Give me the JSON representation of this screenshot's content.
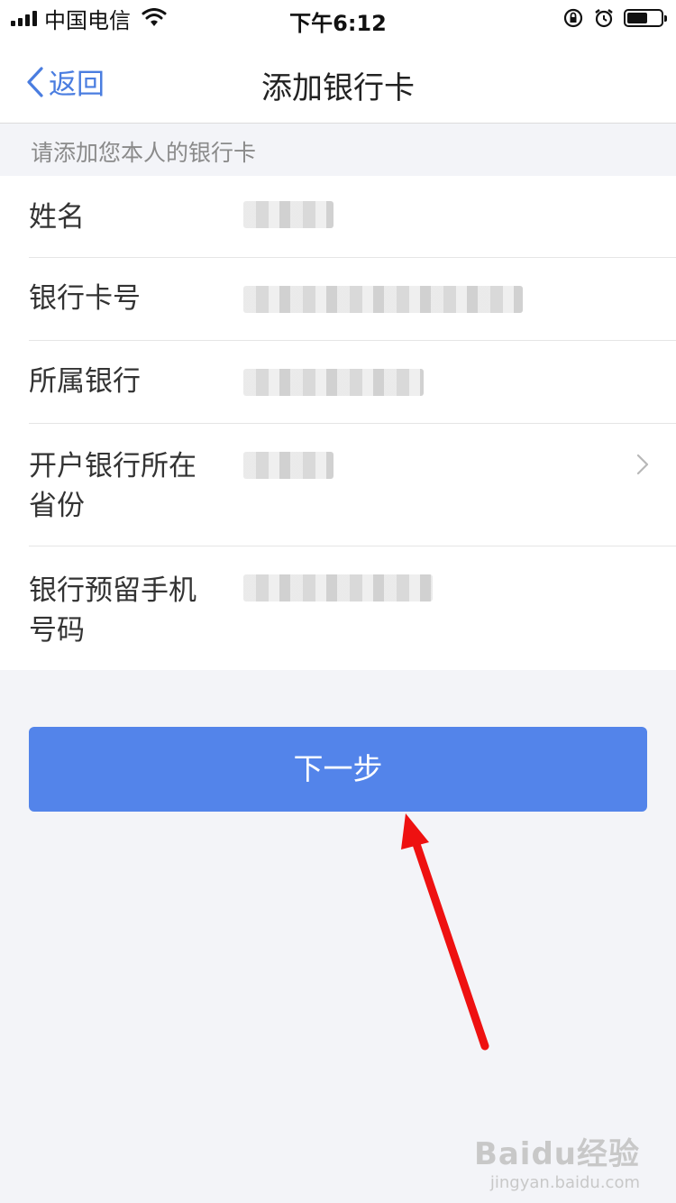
{
  "status_bar": {
    "carrier": "中国电信",
    "time": "下午6:12",
    "battery_level": 0.6
  },
  "nav": {
    "back_label": "返回",
    "title": "添加银行卡"
  },
  "hint": "请添加您本人的银行卡",
  "form": {
    "rows": [
      {
        "label": "姓名"
      },
      {
        "label": "银行卡号"
      },
      {
        "label": "所属银行"
      },
      {
        "label": "开户银行所在省份"
      },
      {
        "label": "银行预留手机号码"
      }
    ]
  },
  "next_button": "下一步",
  "watermark": {
    "brand": "Baidu经验",
    "url": "jingyan.baidu.com"
  },
  "colors": {
    "primary": "#5384ea",
    "back_link": "#4a7de0",
    "annotation_arrow": "#ee1111",
    "background": "#f3f4f8"
  },
  "icons": [
    "signal-icon",
    "wifi-icon",
    "rotation-lock-icon",
    "alarm-icon",
    "battery-icon",
    "chevron-left-icon",
    "chevron-right-icon",
    "annotation-arrow-icon"
  ]
}
